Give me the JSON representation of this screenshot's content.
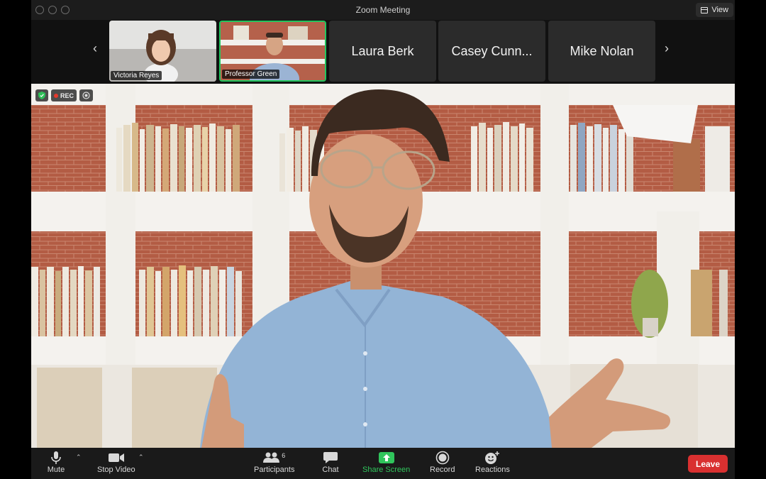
{
  "window": {
    "title": "Zoom Meeting",
    "view_label": "View"
  },
  "thumbnails": [
    {
      "name": "Victoria Reyes",
      "has_video": true
    },
    {
      "name": "Professor Green",
      "has_video": true,
      "active_speaker": true
    },
    {
      "name": "Laura Berk",
      "has_video": false
    },
    {
      "name": "Casey Cunn...",
      "has_video": false
    },
    {
      "name": "Mike Nolan",
      "has_video": false
    }
  ],
  "status": {
    "rec_label": "REC"
  },
  "toolbar": {
    "mute": "Mute",
    "stop_video": "Stop Video",
    "participants": "Participants",
    "participants_count": "6",
    "chat": "Chat",
    "share_screen": "Share Screen",
    "record": "Record",
    "reactions": "Reactions",
    "leave": "Leave"
  },
  "colors": {
    "active_speaker": "#22c55e",
    "share_screen": "#30c55c",
    "leave": "#d93030",
    "recording": "#e5392c"
  },
  "icons": [
    "microphone-icon",
    "video-camera-icon",
    "participants-icon",
    "chat-icon",
    "share-screen-icon",
    "record-icon",
    "reactions-icon",
    "shield-icon",
    "grid-view-icon"
  ]
}
